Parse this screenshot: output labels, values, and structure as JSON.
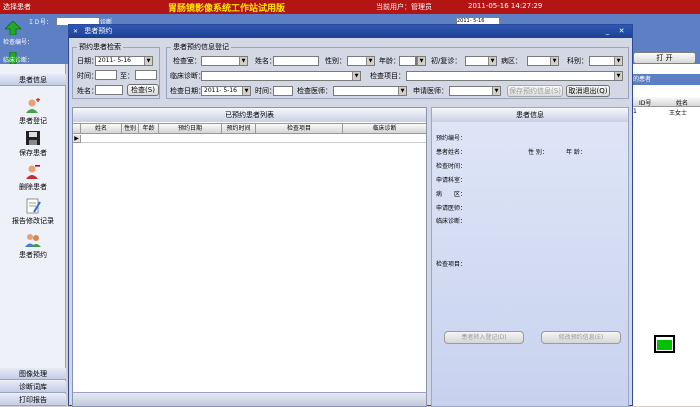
{
  "topbar": {
    "left_label": "选择患者",
    "title": "胃肠镜影像系统工作站试用版",
    "user_label": "当前用户：管理员",
    "datetime": "2011-05-16 14:27:29"
  },
  "band": {
    "id_label": "ＩＤ号：",
    "diag_label": "诊断",
    "exam_no_label": "检查编号：",
    "clinical_label": "临床诊断：",
    "date_value": "2011- 5-16"
  },
  "sidebar": {
    "header": "患者信息",
    "items": [
      {
        "label": "患者登记"
      },
      {
        "label": "保存患者"
      },
      {
        "label": "删除患者"
      },
      {
        "label": "报告修改记录"
      },
      {
        "label": "患者预约"
      }
    ],
    "bottom": [
      {
        "label": "图像处理"
      },
      {
        "label": "诊断词库"
      },
      {
        "label": "打印报告"
      }
    ]
  },
  "right_panel": {
    "open_button": "打 开",
    "header": "的患者",
    "col_id": "ID号",
    "col_name": "姓名",
    "row_id": "1",
    "row_name": "王女士",
    "indicator_color": "#00c000"
  },
  "modal": {
    "title": "患者预约",
    "query_group": {
      "label": "预约患者检索",
      "date_label": "日期：",
      "date_value": "2011- 5-16",
      "time_label": "时间：",
      "to_label": "至：",
      "name_label": "姓名：",
      "search_button": "检查(S)"
    },
    "register_group": {
      "label": "患者预约信息登记",
      "exam_room_label": "检查室：",
      "name_label": "姓名：",
      "sex_label": "性别：",
      "age_label": "年龄：",
      "first_visit_label": "初/复诊：",
      "ward_label": "病区：",
      "dept_label": "科别：",
      "clinical_label": "临床诊断：",
      "exam_item_label": "检查项目：",
      "exam_date_label": "检查日期：",
      "exam_date_value": "2011- 5-16",
      "time_label": "时间：",
      "doctor_label": "检查医师：",
      "applicant_label": "申请医师：",
      "save_button": "保存预约信息(S)",
      "cancel_button": "取消退出(Q)"
    },
    "list": {
      "caption": "已预约患者列表",
      "columns": [
        "姓名",
        "性别",
        "年龄",
        "预约日期",
        "预约时间",
        "检查项目",
        "临床诊断"
      ]
    },
    "info": {
      "caption": "患者信息",
      "fields": [
        "预约编号：",
        "患者姓名：",
        "检查时间：",
        "申请科室：",
        "病　　区：",
        "申请医师：",
        "临床诊断："
      ],
      "sex_label": "性 别：",
      "age_label": "年 龄：",
      "exam_item_label": "检查项目：",
      "transfer_button": "患者转入登记(D)",
      "modify_button": "修改预约信息(E)"
    }
  }
}
